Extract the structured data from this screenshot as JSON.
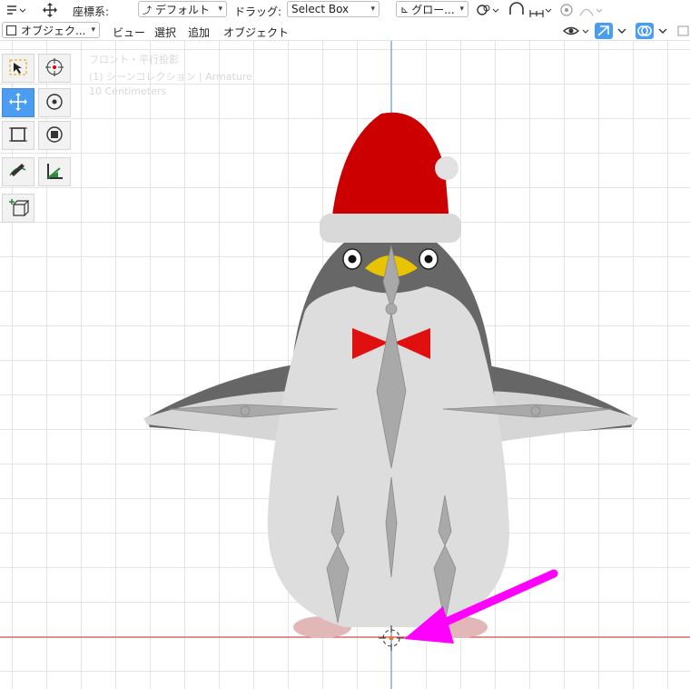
{
  "header": {
    "transform_label": "座標系:",
    "orientation": "デフォルト",
    "drag_label": "ドラッグ:",
    "drag_mode": "Select Box",
    "pivot": "グロー..."
  },
  "menubar": {
    "mode": "オブジェク...",
    "view": "ビュー",
    "select": "選択",
    "add": "追加",
    "object": "オブジェクト"
  },
  "viewport": {
    "view_name": "フロント・平行投影",
    "collection": "(1) シーンコレクション | Armature",
    "scale": "10 Centimeters"
  },
  "colors": {
    "accent": "#4a9df0",
    "hat": "#cc0000",
    "bowtie": "#e01010",
    "beak": "#e8c400",
    "arrow": "#ff00ff",
    "x_axis": "#d9534f",
    "z_axis": "#6aa0e0"
  },
  "toolbar": {
    "tools": [
      "select-box-icon",
      "cursor-icon",
      "move-icon",
      "rotate-icon",
      "scale-icon",
      "transform-icon",
      "annotate-icon",
      "measure-icon",
      "add-cube-icon"
    ]
  }
}
